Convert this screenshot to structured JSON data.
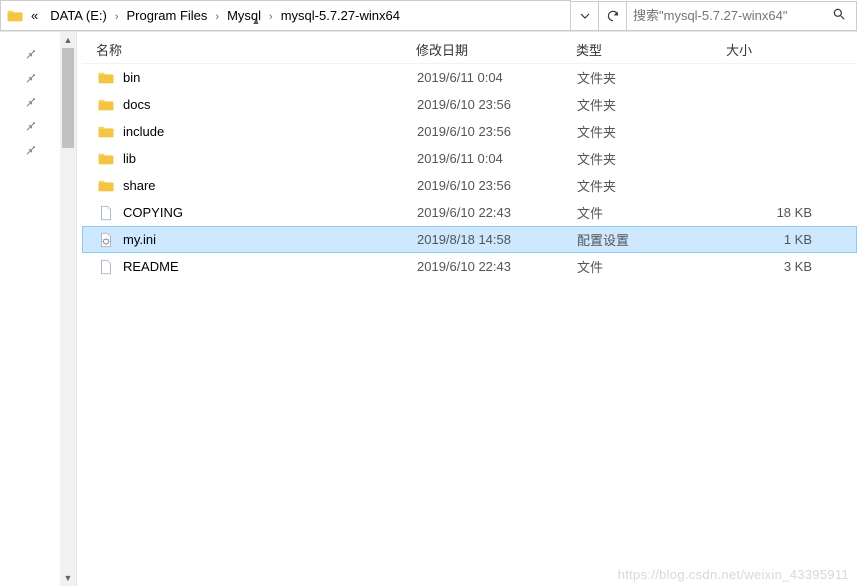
{
  "breadcrumb": {
    "truncated": "«",
    "segments": [
      "DATA (E:)",
      "Program Files",
      "Mysql",
      "mysql-5.7.27-winx64"
    ]
  },
  "search": {
    "placeholder": "搜索\"mysql-5.7.27-winx64\""
  },
  "columns": {
    "name": "名称",
    "date": "修改日期",
    "type": "类型",
    "size": "大小"
  },
  "files": [
    {
      "icon": "folder",
      "name": "bin",
      "date": "2019/6/11 0:04",
      "type": "文件夹",
      "size": ""
    },
    {
      "icon": "folder",
      "name": "docs",
      "date": "2019/6/10 23:56",
      "type": "文件夹",
      "size": ""
    },
    {
      "icon": "folder",
      "name": "include",
      "date": "2019/6/10 23:56",
      "type": "文件夹",
      "size": ""
    },
    {
      "icon": "folder",
      "name": "lib",
      "date": "2019/6/11 0:04",
      "type": "文件夹",
      "size": ""
    },
    {
      "icon": "folder",
      "name": "share",
      "date": "2019/6/10 23:56",
      "type": "文件夹",
      "size": ""
    },
    {
      "icon": "file",
      "name": "COPYING",
      "date": "2019/6/10 22:43",
      "type": "文件",
      "size": "18 KB"
    },
    {
      "icon": "ini",
      "name": "my.ini",
      "date": "2019/8/18 14:58",
      "type": "配置设置",
      "size": "1 KB",
      "selected": true
    },
    {
      "icon": "file",
      "name": "README",
      "date": "2019/6/10 22:43",
      "type": "文件",
      "size": "3 KB"
    }
  ],
  "watermark": "https://blog.csdn.net/weixin_43395911"
}
